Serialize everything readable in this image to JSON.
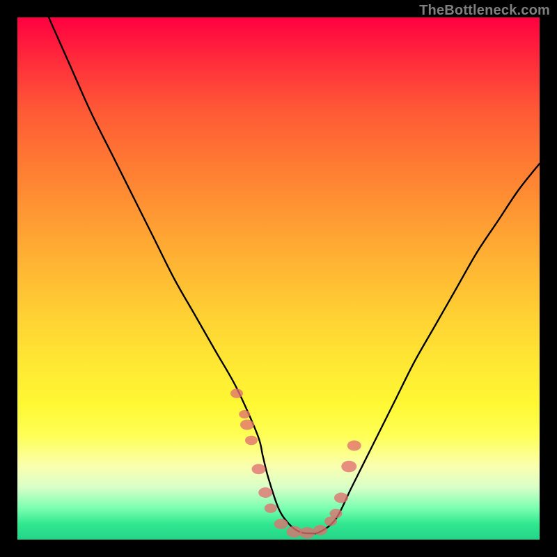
{
  "watermark": "TheBottleneck.com",
  "chart_data": {
    "type": "line",
    "title": "",
    "xlabel": "",
    "ylabel": "",
    "xlim": [
      0,
      100
    ],
    "ylim": [
      0,
      100
    ],
    "grid": false,
    "series": [
      {
        "name": "curve",
        "x": [
          6,
          10,
          14,
          18,
          22,
          26,
          30,
          34,
          38,
          42,
          46,
          47,
          48,
          50,
          52,
          54,
          56,
          58,
          61,
          64,
          68,
          72,
          76,
          80,
          84,
          88,
          92,
          96,
          100
        ],
        "y": [
          100,
          91,
          82,
          74,
          66,
          58,
          50,
          43,
          36,
          29,
          20,
          16,
          12,
          6,
          3,
          1.5,
          1.2,
          1.5,
          4,
          10,
          18,
          26,
          34,
          41,
          48,
          55,
          61,
          67,
          72
        ]
      }
    ],
    "markers": {
      "name": "highlight-points",
      "x": [
        42,
        43.5,
        44,
        44.8,
        46.2,
        47.5,
        48.5,
        50.5,
        53,
        55.5,
        58,
        60,
        61,
        62,
        63.5,
        64.5
      ],
      "y": [
        28,
        24,
        22,
        19,
        13.5,
        9,
        6,
        3,
        1.5,
        1.3,
        1.8,
        3.5,
        5,
        8,
        14,
        18
      ],
      "size": [
        9,
        8,
        10,
        9,
        10,
        10,
        9,
        10,
        11,
        11,
        10,
        9,
        9,
        10,
        11,
        10
      ]
    }
  }
}
